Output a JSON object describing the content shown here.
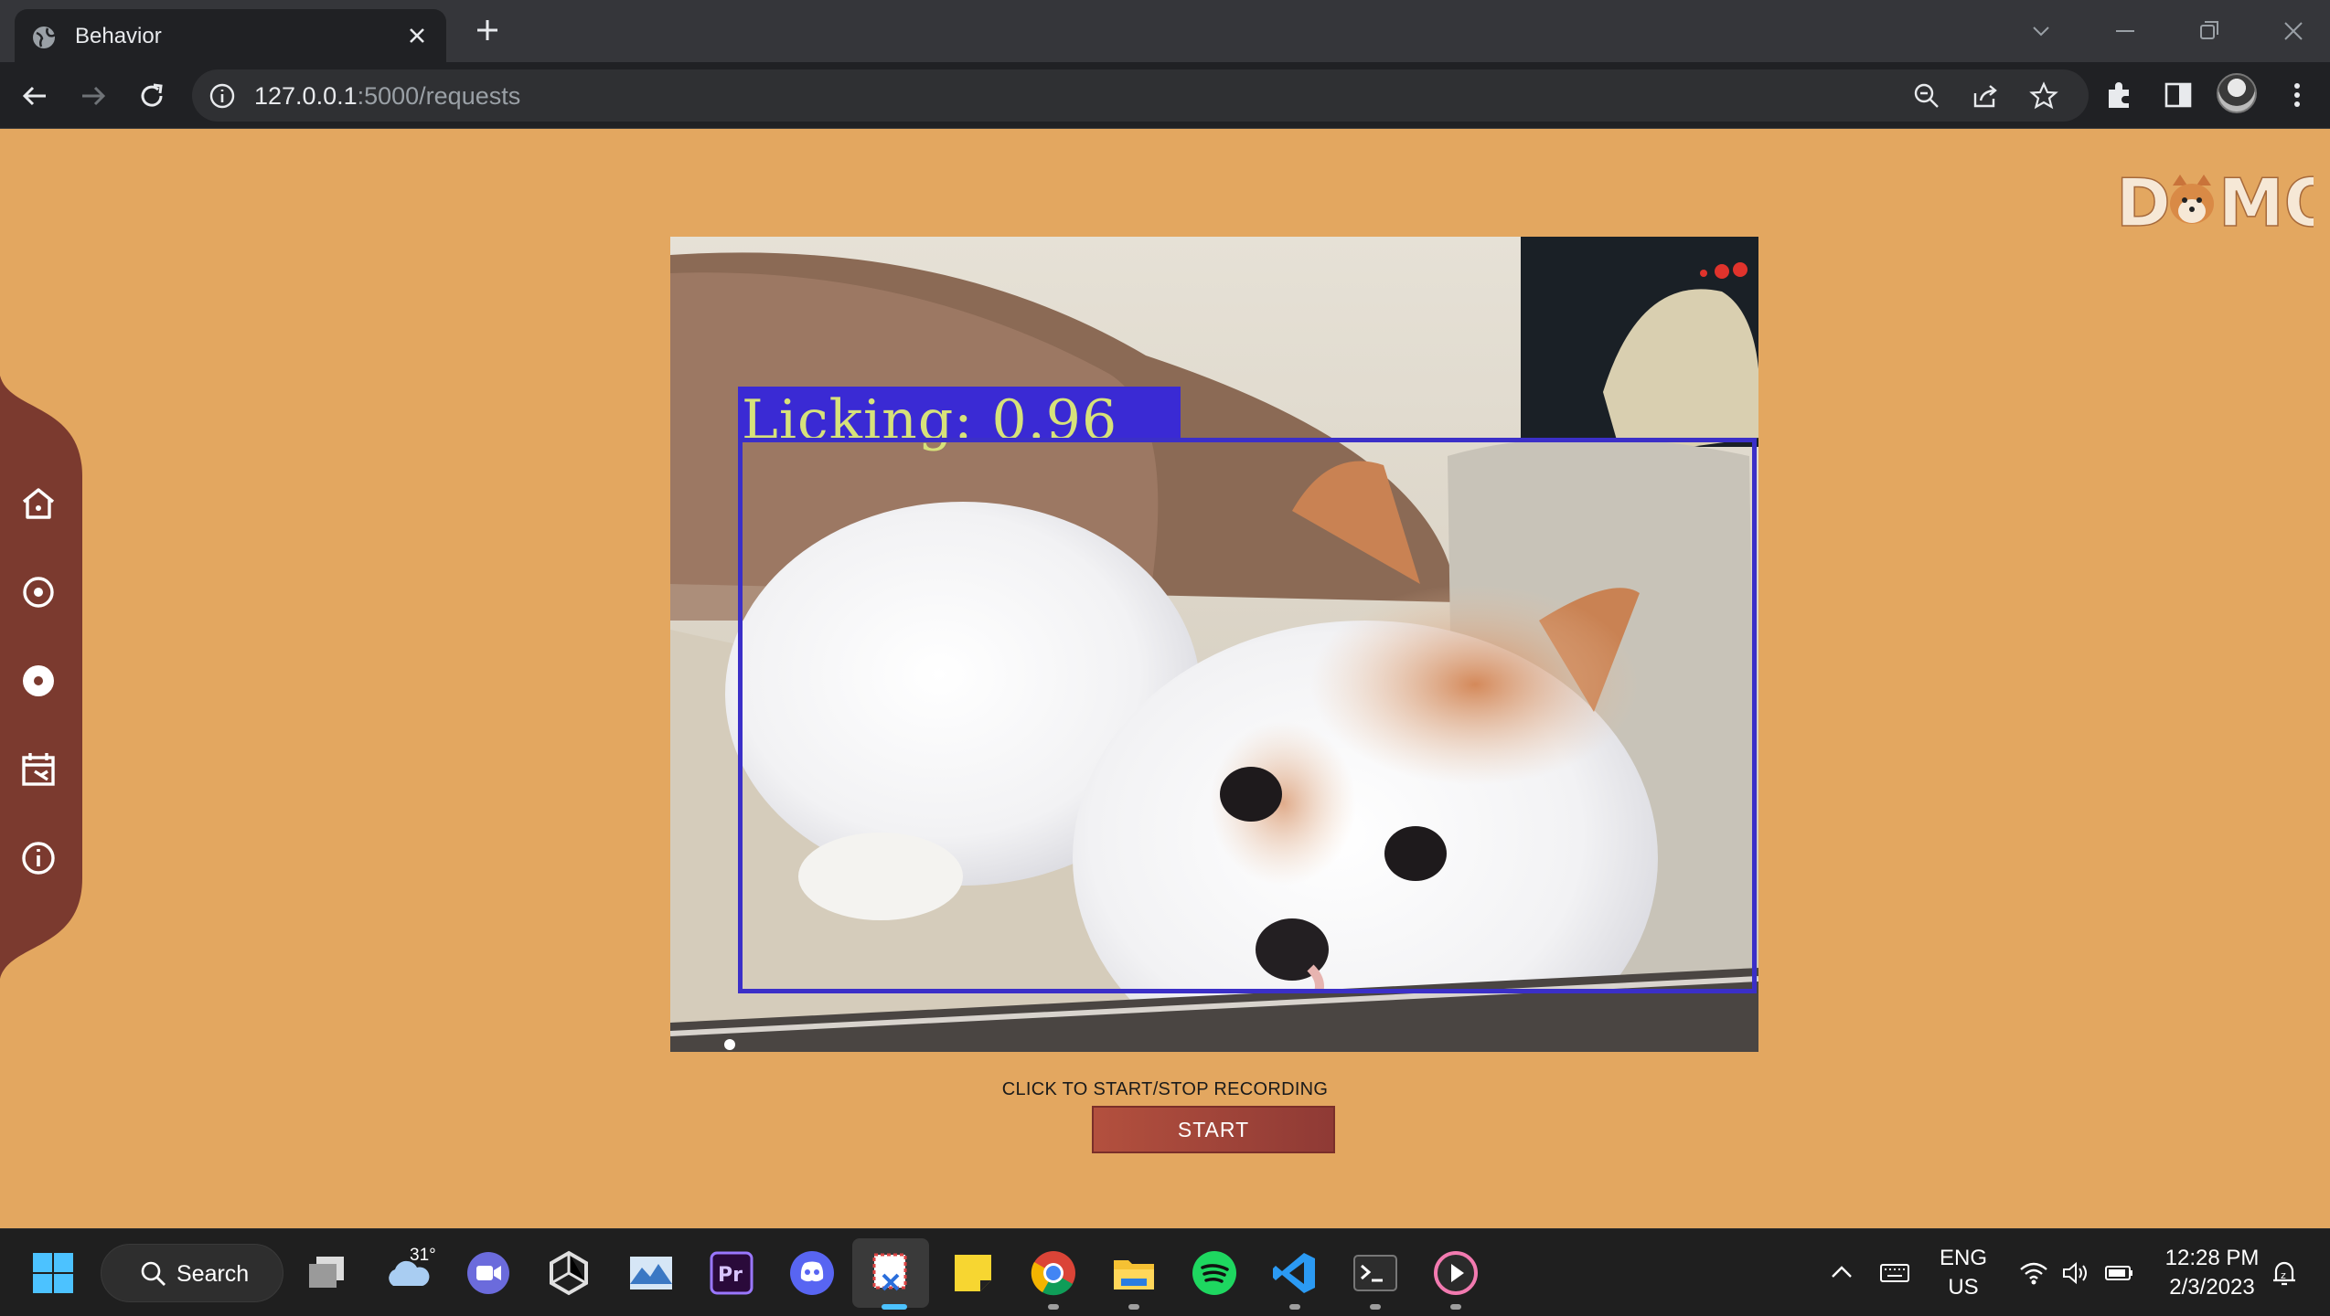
{
  "browser": {
    "tab_title": "Behavior",
    "url_host": "127.0.0.1",
    "url_path": ":5000/requests"
  },
  "page": {
    "logo_text": "DOMO",
    "detection": {
      "label": "Licking:",
      "confidence": "0.96"
    },
    "record_hint": "CLICK TO START/STOP RECORDING",
    "start_label": "START",
    "sidebar_icons": [
      "home-icon",
      "target-icon",
      "record-icon",
      "calendar-icon",
      "info-icon"
    ]
  },
  "taskbar": {
    "search_label": "Search",
    "weather_temp": "31°",
    "language": "ENG",
    "region": "US",
    "time": "12:28 PM",
    "date": "2/3/2023",
    "apps": [
      "task-view",
      "weather",
      "zoom",
      "unity",
      "mountain-app",
      "premiere",
      "discord",
      "snipping-tool",
      "sticky-notes",
      "chrome",
      "file-explorer",
      "spotify",
      "vscode",
      "terminal",
      "media-player"
    ]
  },
  "colors": {
    "page_bg": "#e3a760",
    "sidebar": "#7b3a2f",
    "start_button": "#a8473b",
    "detection_box": "#3b2fc8"
  }
}
